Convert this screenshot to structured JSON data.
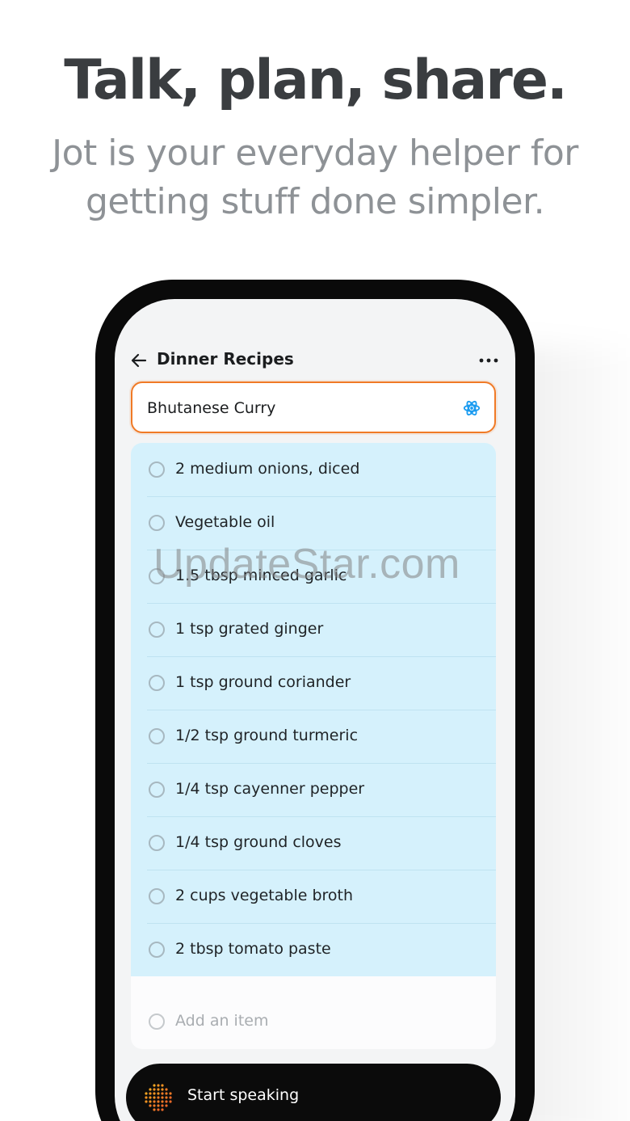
{
  "hero": {
    "title": "Talk, plan, share.",
    "subtitle_line1": "Jot is your everyday helper for",
    "subtitle_line2": "getting stuff done simpler."
  },
  "app": {
    "header": {
      "back_icon": "arrow-left-icon",
      "title": "Dinner Recipes",
      "more_icon": "more-horizontal-icon"
    },
    "name_field": {
      "value": "Bhutanese Curry",
      "icon": "atom-icon"
    },
    "items": [
      {
        "label": "2 medium onions, diced",
        "checked": false
      },
      {
        "label": "Vegetable oil",
        "checked": false
      },
      {
        "label": "1.5 tbsp minced garlic",
        "checked": false
      },
      {
        "label": "1 tsp grated ginger",
        "checked": false
      },
      {
        "label": "1 tsp ground coriander",
        "checked": false
      },
      {
        "label": "1/2 tsp ground turmeric",
        "checked": false
      },
      {
        "label": "1/4 tsp cayenner pepper",
        "checked": false
      },
      {
        "label": "1/4 tsp ground cloves",
        "checked": false
      },
      {
        "label": "2 cups vegetable broth",
        "checked": false
      },
      {
        "label": "2 tbsp tomato paste",
        "checked": false
      }
    ],
    "add_item": {
      "placeholder": "Add an item"
    },
    "speak": {
      "label": "Start speaking",
      "icon": "dotted-mic-icon"
    }
  },
  "watermark": "UpdateStar.com",
  "colors": {
    "accent_orange": "#f07a26",
    "list_bg": "#d5f1fc",
    "atom_blue": "#1a9bf0"
  }
}
